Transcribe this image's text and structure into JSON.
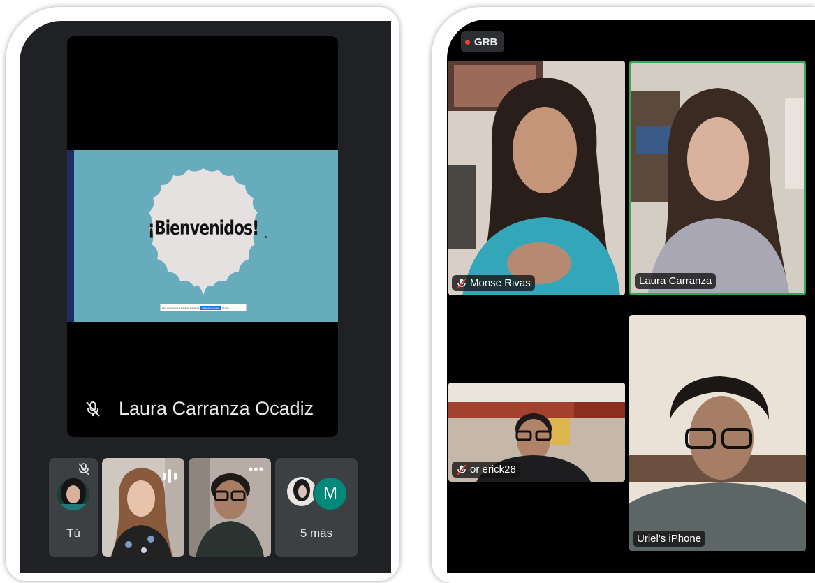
{
  "left_app": {
    "slide": {
      "title": "¡Bienvenidos!",
      "share_notice": "Está presentando a todos los asistentes",
      "stop_button": "Dejar de presentar",
      "hide_button": "Ocultar"
    },
    "main_speaker": {
      "name": "Laura Carranza Ocadiz",
      "muted": true
    },
    "thumbnails": {
      "self_label": "Tú",
      "more_label": "5 más",
      "more_avatar_letter": "M"
    },
    "colors": {
      "background": "#202124",
      "avatar_M": "#00897b",
      "slide": "#66acbd"
    }
  },
  "right_app": {
    "recording_label": "GRB",
    "participants": [
      {
        "name": "Monse Rivas",
        "muted": true
      },
      {
        "name": "Laura Carranza",
        "muted": false,
        "active_speaker": true
      },
      {
        "name": "or erick28",
        "muted": true
      },
      {
        "name": "Uriel's iPhone",
        "muted": false
      }
    ],
    "colors": {
      "active_border": "#34a853",
      "record_dot": "#ea4335"
    }
  }
}
